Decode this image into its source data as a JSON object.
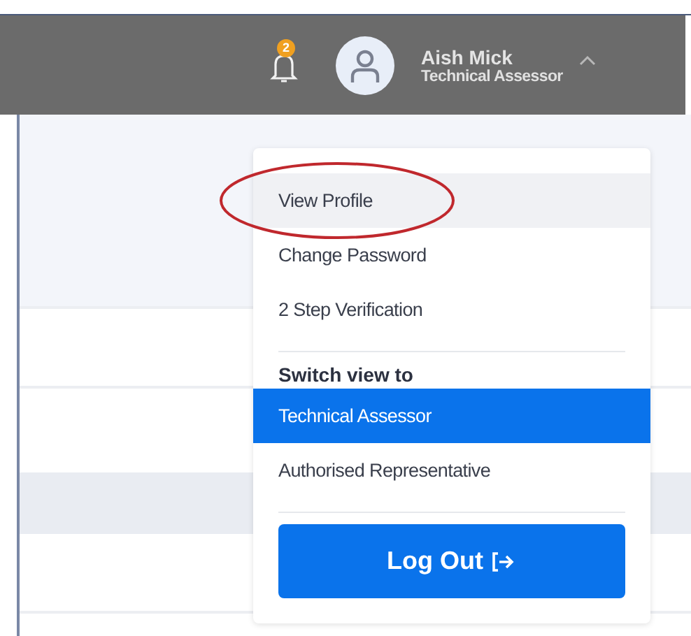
{
  "header": {
    "notification_count": "2",
    "user": {
      "name": "Aish Mick",
      "role": "Technical Assessor"
    },
    "menu_expanded": true
  },
  "menu": {
    "items": [
      {
        "label": "View Profile",
        "hovered": true,
        "circled": true
      },
      {
        "label": "Change Password",
        "hovered": false,
        "circled": false
      },
      {
        "label": "2 Step Verification",
        "hovered": false,
        "circled": false
      }
    ],
    "switch_view": {
      "heading": "Switch view to",
      "options": [
        {
          "label": "Technical Assessor",
          "selected": true
        },
        {
          "label": "Authorised Representative",
          "selected": false
        }
      ]
    },
    "logout_button": {
      "label": "Log Out"
    }
  }
}
